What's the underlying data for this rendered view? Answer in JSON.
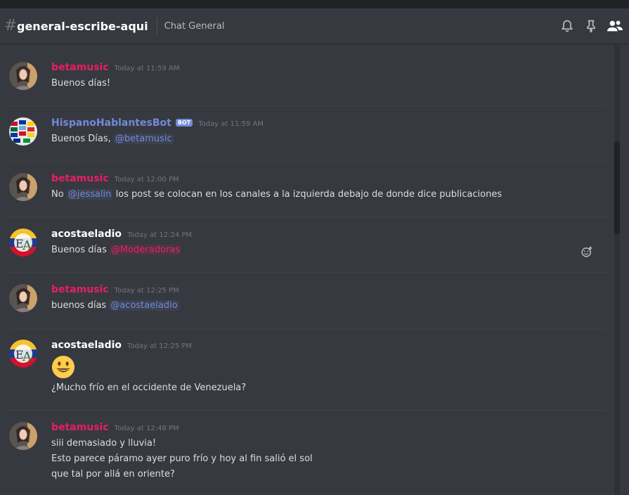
{
  "header": {
    "hash": "#",
    "channel_name": "general-escribe-aqui",
    "topic": "Chat General",
    "icons": [
      "bell-icon",
      "pin-icon",
      "members-icon"
    ]
  },
  "messages": [
    {
      "author": "betamusic",
      "author_color": "#e91e63",
      "timestamp": "Today at 11:59 AM",
      "lines": [
        "Buenos días!"
      ]
    },
    {
      "author": "HispanoHablantesBot",
      "author_color": "#7289da",
      "bot_tag": "BOT",
      "timestamp": "Today at 11:59 AM",
      "text": "Buenos Días,",
      "mention": "@betamusic"
    },
    {
      "author": "betamusic",
      "author_color": "#e91e63",
      "timestamp": "Today at 12:00 PM",
      "pre": "No",
      "mention": "@jessalin",
      "post": "los post se colocan en los canales a la izquierda debajo de donde dice publicaciones"
    },
    {
      "author": "acostaeladio",
      "author_color": "#ffffff",
      "timestamp": "Today at 12:24 PM",
      "text": "Buenos días",
      "mention": "@Moderadoras",
      "reaction_icon": "add-reaction-icon"
    },
    {
      "author": "betamusic",
      "author_color": "#e91e63",
      "timestamp": "Today at 12:25 PM",
      "text": "buenos días",
      "mention": "@acostaeladio"
    },
    {
      "author": "acostaeladio",
      "author_color": "#ffffff",
      "timestamp": "Today at 12:25 PM",
      "emoji": "smiley-emoji",
      "lines": [
        "¿Mucho frío en el occidente de Venezuela?"
      ]
    },
    {
      "author": "betamusic",
      "author_color": "#e91e63",
      "timestamp": "Today at 12:48 PM",
      "lines": [
        "siii demasiado y lluvia!",
        "Esto parece páramo ayer puro frío y hoy al fin salió el sol",
        "que tal por allá en oriente?"
      ]
    }
  ],
  "colors": {
    "background": "#36393f",
    "mention": "#7289da",
    "role_mention": "#e91e63"
  }
}
